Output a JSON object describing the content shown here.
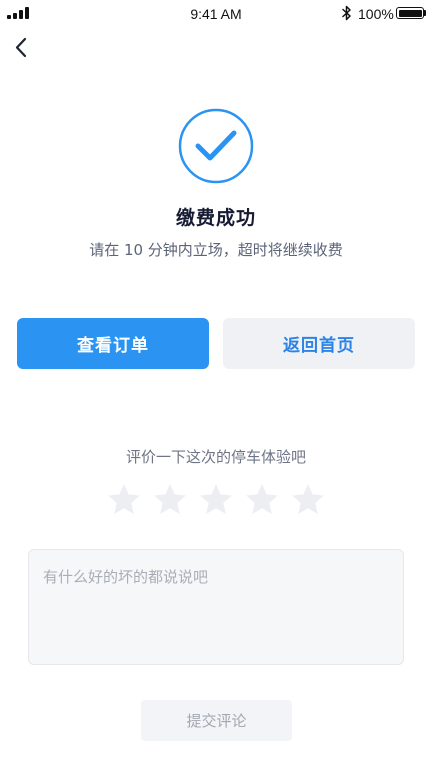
{
  "status_bar": {
    "time": "9:41 AM",
    "battery_text": "100%",
    "signal_icon": "signal-bars-icon",
    "bluetooth_icon": "bluetooth-icon",
    "battery_icon": "battery-full-icon"
  },
  "nav": {
    "back_icon": "chevron-left-icon"
  },
  "success": {
    "icon": "check-circle-icon",
    "title": "缴费成功",
    "subtitle": "请在 10 分钟内立场，超时将继续收费"
  },
  "actions": {
    "view_order_label": "查看订单",
    "home_label": "返回首页"
  },
  "rating": {
    "prompt": "评价一下这次的停车体验吧",
    "max_stars": 5,
    "selected_stars": 0,
    "star_icon": "star-icon"
  },
  "comment": {
    "placeholder": "有什么好的坏的都说说吧",
    "value": ""
  },
  "submit": {
    "label": "提交评论"
  },
  "colors": {
    "accent": "#2b94f3",
    "secondary_bg": "#f0f1f5",
    "secondary_text": "#2b83e6",
    "star_inactive": "#eceef1",
    "title_text": "#161b33"
  }
}
